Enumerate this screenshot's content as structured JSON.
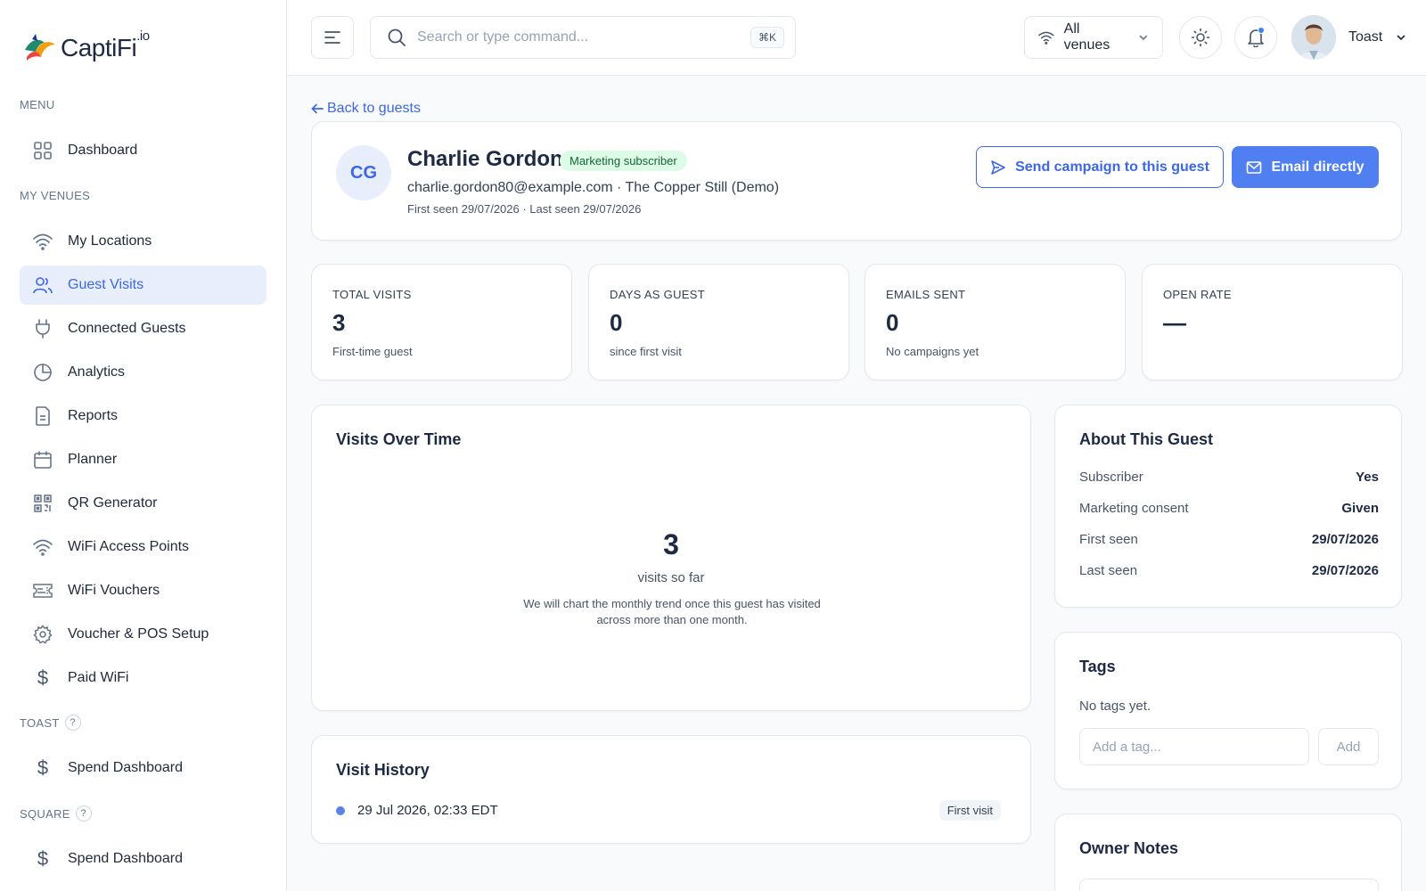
{
  "brand": {
    "name": "CaptiFi",
    "suffix": ".io"
  },
  "sidebar": {
    "menu_label": "MENU",
    "my_venues_label": "MY VENUES",
    "toast_label": "TOAST",
    "square_label": "SQUARE",
    "help_glyph": "?",
    "items": [
      {
        "label": "Dashboard",
        "icon": "grid-icon"
      },
      {
        "label": "My Locations",
        "icon": "wifi-icon"
      },
      {
        "label": "Guest Visits",
        "icon": "users-icon",
        "active": true
      },
      {
        "label": "Connected Guests",
        "icon": "plug-icon"
      },
      {
        "label": "Analytics",
        "icon": "pie-chart-icon"
      },
      {
        "label": "Reports",
        "icon": "document-icon"
      },
      {
        "label": "Planner",
        "icon": "calendar-icon"
      },
      {
        "label": "QR Generator",
        "icon": "qr-code-icon"
      },
      {
        "label": "WiFi Access Points",
        "icon": "wifi-icon"
      },
      {
        "label": "WiFi Vouchers",
        "icon": "ticket-icon"
      },
      {
        "label": "Voucher & POS Setup",
        "icon": "gear-icon"
      },
      {
        "label": "Paid WiFi",
        "icon": "dollar-icon"
      }
    ],
    "toast_items": [
      {
        "label": "Spend Dashboard",
        "icon": "dollar-icon"
      }
    ],
    "square_items": [
      {
        "label": "Spend Dashboard",
        "icon": "dollar-icon"
      }
    ]
  },
  "topbar": {
    "search_placeholder": "Search or type command...",
    "shortcut": "⌘K",
    "venue_selector": "All venues",
    "user_name": "Toast"
  },
  "back_link": "Back to guests",
  "guest": {
    "initials": "CG",
    "name": "Charlie Gordon",
    "badge": "Marketing subscriber",
    "meta": "charlie.gordon80@example.com · The Copper Still (Demo)",
    "seen": "First seen 29/07/2026 · Last seen 29/07/2026",
    "send_campaign_label": "Send campaign to this guest",
    "email_label": "Email directly"
  },
  "stats": [
    {
      "label": "TOTAL VISITS",
      "value": "3",
      "sub": "First-time guest"
    },
    {
      "label": "DAYS AS GUEST",
      "value": "0",
      "sub": "since first visit"
    },
    {
      "label": "EMAILS SENT",
      "value": "0",
      "sub": "No campaigns yet"
    },
    {
      "label": "OPEN RATE",
      "value": "—",
      "sub": ""
    }
  ],
  "visits_over_time": {
    "title": "Visits Over Time",
    "count": "3",
    "count_label": "visits so far",
    "note": "We will chart the monthly trend once this guest has visited across more than one month."
  },
  "visit_history": {
    "title": "Visit History",
    "entries": [
      {
        "datetime": "29 Jul 2026, 02:33 EDT",
        "tag": "First visit"
      }
    ]
  },
  "about": {
    "title": "About This Guest",
    "rows": [
      {
        "key": "Subscriber",
        "value": "Yes"
      },
      {
        "key": "Marketing consent",
        "value": "Given"
      },
      {
        "key": "First seen",
        "value": "29/07/2026"
      },
      {
        "key": "Last seen",
        "value": "29/07/2026"
      }
    ]
  },
  "tags": {
    "title": "Tags",
    "empty": "No tags yet.",
    "input_placeholder": "Add a tag...",
    "add_label": "Add"
  },
  "notes": {
    "title": "Owner Notes"
  },
  "colors": {
    "accent": "#3b67e8",
    "accent_solid": "#4f7ff0",
    "badge_bg": "#dcfce7",
    "badge_text": "#166534"
  }
}
